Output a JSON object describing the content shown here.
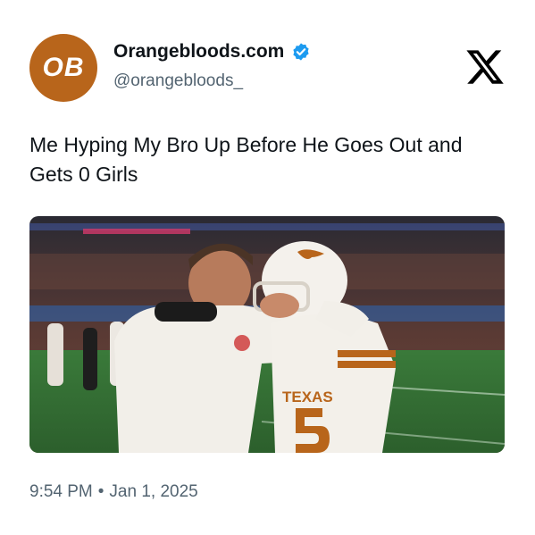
{
  "account": {
    "avatar_text": "OB",
    "display_name": "Orangebloods.com",
    "handle": "@orangebloods_",
    "verified": true,
    "verified_icon": "verified-badge-icon",
    "brand_color": "#b8651b",
    "badge_color": "#1d9bf0"
  },
  "platform": {
    "logo_icon": "x-logo-icon"
  },
  "tweet": {
    "text": "Me Hyping My Bro Up Before He Goes Out and Gets 0 Girls",
    "media_image_text": "TEXAS"
  },
  "meta": {
    "time": "9:54 PM",
    "separator": "•",
    "date": "Jan 1, 2025"
  }
}
